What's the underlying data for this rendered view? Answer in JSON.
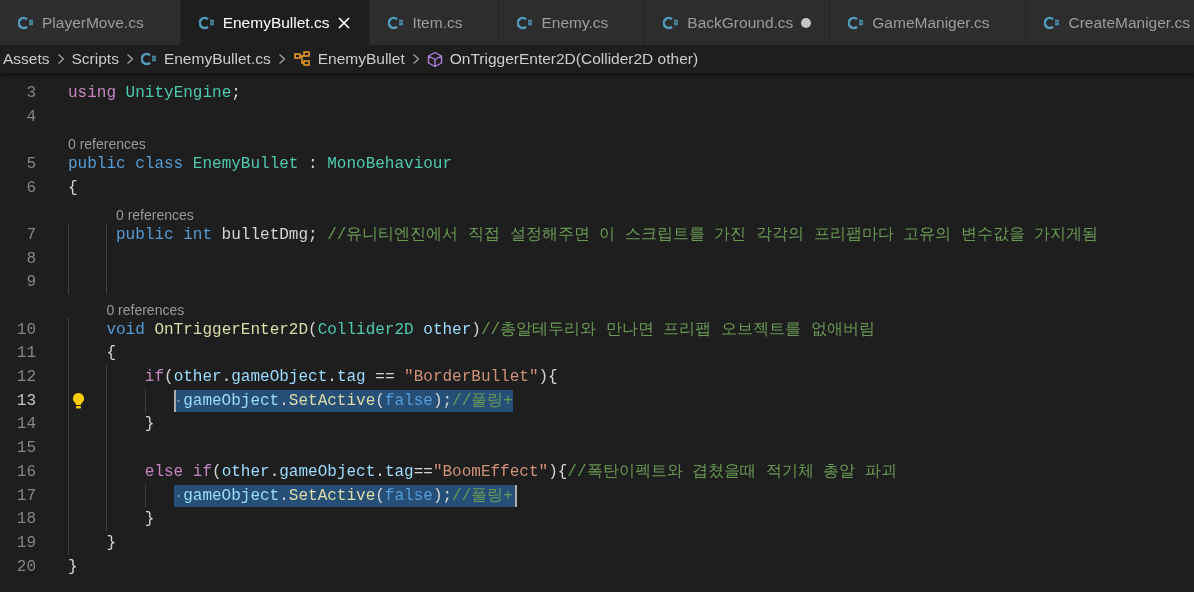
{
  "tabs": [
    {
      "label": "PlayerMove.cs",
      "selected": false,
      "modified": false
    },
    {
      "label": "EnemyBullet.cs",
      "selected": true,
      "modified": false
    },
    {
      "label": "Item.cs",
      "selected": false,
      "modified": false
    },
    {
      "label": "Enemy.cs",
      "selected": false,
      "modified": false
    },
    {
      "label": "BackGround.cs",
      "selected": false,
      "modified": true
    },
    {
      "label": "GameManiger.cs",
      "selected": false,
      "modified": false
    },
    {
      "label": "CreateManiger.cs",
      "selected": false,
      "modified": false
    }
  ],
  "breadcrumb": [
    {
      "kind": "folder",
      "label": "Assets"
    },
    {
      "kind": "folder",
      "label": "Scripts"
    },
    {
      "kind": "file",
      "label": "EnemyBullet.cs"
    },
    {
      "kind": "class",
      "label": "EnemyBullet"
    },
    {
      "kind": "method",
      "label": "OnTriggerEnter2D(Collider2D other)"
    }
  ],
  "lines": [
    {
      "number": "3",
      "tokens": [
        {
          "kind": "control",
          "text": "using"
        },
        {
          "kind": "type",
          "text": " UnityEngine"
        },
        {
          "kind": "plain",
          "text": ";"
        }
      ]
    },
    {
      "number": "4"
    },
    {
      "number": "5",
      "codelens": "0 references",
      "tokens": [
        {
          "kind": "keyword",
          "text": "public class"
        },
        {
          "kind": "type",
          "text": " EnemyBullet"
        },
        {
          "kind": "plain",
          "text": " : "
        },
        {
          "kind": "type",
          "text": "MonoBehaviour"
        }
      ]
    },
    {
      "number": "6",
      "tokens": [
        {
          "kind": "plain",
          "text": "{"
        }
      ]
    },
    {
      "number": "7",
      "codelens": "0 references",
      "tokens": [
        {
          "kind": "keyword",
          "text": "     public int"
        },
        {
          "kind": "plain",
          "text": " bulletDmg; "
        },
        {
          "kind": "comment",
          "text": "//유니티엔진에서 직접 설정해주면 이 스크립트를 가진 각각의 프리팹마다 고유의 변수값을 가지게됨"
        }
      ]
    },
    {
      "number": "8"
    },
    {
      "number": "9"
    },
    {
      "number": "10",
      "codelens": "0 references",
      "tokens": [
        {
          "kind": "keyword",
          "text": "    void"
        },
        {
          "kind": "function",
          "text": " OnTriggerEnter2D"
        },
        {
          "kind": "plain",
          "text": "("
        },
        {
          "kind": "type",
          "text": "Collider2D"
        },
        {
          "kind": "variable",
          "text": " other"
        },
        {
          "kind": "plain",
          "text": ")"
        },
        {
          "kind": "comment",
          "text": "//총알테두리와 만나면 프리팹 오브젝트를 없애버림"
        }
      ]
    },
    {
      "number": "11",
      "tokens": [
        {
          "kind": "plain",
          "text": "    {"
        }
      ]
    },
    {
      "number": "12",
      "tokens": [
        {
          "kind": "control",
          "text": "        if"
        },
        {
          "kind": "plain",
          "text": "("
        },
        {
          "kind": "variable",
          "text": "other"
        },
        {
          "kind": "plain",
          "text": "."
        },
        {
          "kind": "variable",
          "text": "gameObject"
        },
        {
          "kind": "plain",
          "text": "."
        },
        {
          "kind": "variable",
          "text": "tag"
        },
        {
          "kind": "plain",
          "text": " == "
        },
        {
          "kind": "string",
          "text": "\"BorderBullet\""
        },
        {
          "kind": "plain",
          "text": "){"
        }
      ]
    },
    {
      "number": "13",
      "current": true,
      "lightbulb": true,
      "selected": true,
      "cursor_at_end": false,
      "tokens": [
        {
          "kind": "variable",
          "text": "            gameObject"
        },
        {
          "kind": "plain",
          "text": "."
        },
        {
          "kind": "function",
          "text": "SetActive"
        },
        {
          "kind": "plain",
          "text": "("
        },
        {
          "kind": "keyword",
          "text": "false"
        },
        {
          "kind": "plain",
          "text": ");"
        },
        {
          "kind": "comment",
          "text": "//풀링+"
        }
      ]
    },
    {
      "number": "14",
      "tokens": [
        {
          "kind": "plain",
          "text": "        }"
        }
      ]
    },
    {
      "number": "15"
    },
    {
      "number": "16",
      "tokens": [
        {
          "kind": "control",
          "text": "        else if"
        },
        {
          "kind": "plain",
          "text": "("
        },
        {
          "kind": "variable",
          "text": "other"
        },
        {
          "kind": "plain",
          "text": "."
        },
        {
          "kind": "variable",
          "text": "gameObject"
        },
        {
          "kind": "plain",
          "text": "."
        },
        {
          "kind": "variable",
          "text": "tag"
        },
        {
          "kind": "plain",
          "text": "=="
        },
        {
          "kind": "string",
          "text": "\"BoomEffect\""
        },
        {
          "kind": "plain",
          "text": "){"
        },
        {
          "kind": "comment",
          "text": "//폭탄이펙트와 겹쳤을때 적기체 총알 파괴"
        }
      ]
    },
    {
      "number": "17",
      "selected": true,
      "cursor_at_end": true,
      "tokens": [
        {
          "kind": "variable",
          "text": "            gameObject"
        },
        {
          "kind": "plain",
          "text": "."
        },
        {
          "kind": "function",
          "text": "SetActive"
        },
        {
          "kind": "plain",
          "text": "("
        },
        {
          "kind": "keyword",
          "text": "false"
        },
        {
          "kind": "plain",
          "text": ");"
        },
        {
          "kind": "comment",
          "text": "//풀링+"
        }
      ]
    },
    {
      "number": "18",
      "tokens": [
        {
          "kind": "plain",
          "text": "        }"
        }
      ]
    },
    {
      "number": "19",
      "tokens": [
        {
          "kind": "plain",
          "text": "    }"
        }
      ]
    },
    {
      "number": "20",
      "tokens": [
        {
          "kind": "plain",
          "text": "}"
        }
      ]
    }
  ]
}
